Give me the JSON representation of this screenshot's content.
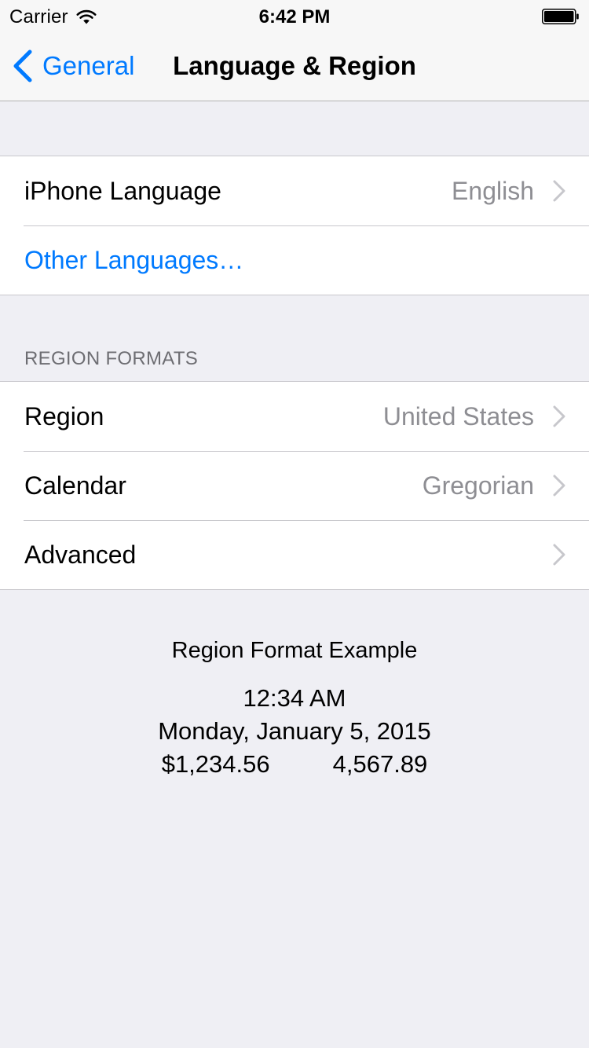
{
  "status_bar": {
    "carrier": "Carrier",
    "time": "6:42 PM"
  },
  "nav": {
    "back_label": "General",
    "title": "Language & Region"
  },
  "language_group": {
    "iphone_language_label": "iPhone Language",
    "iphone_language_value": "English",
    "other_languages_label": "Other Languages…"
  },
  "region_formats": {
    "header": "REGION FORMATS",
    "region_label": "Region",
    "region_value": "United States",
    "calendar_label": "Calendar",
    "calendar_value": "Gregorian",
    "advanced_label": "Advanced"
  },
  "example": {
    "title": "Region Format Example",
    "time": "12:34 AM",
    "date": "Monday, January 5, 2015",
    "currency": "$1,234.56",
    "number": "4,567.89"
  },
  "colors": {
    "accent": "#007aff",
    "background": "#efeff4",
    "secondary_text": "#8e8e93",
    "section_header": "#6d6d72"
  }
}
